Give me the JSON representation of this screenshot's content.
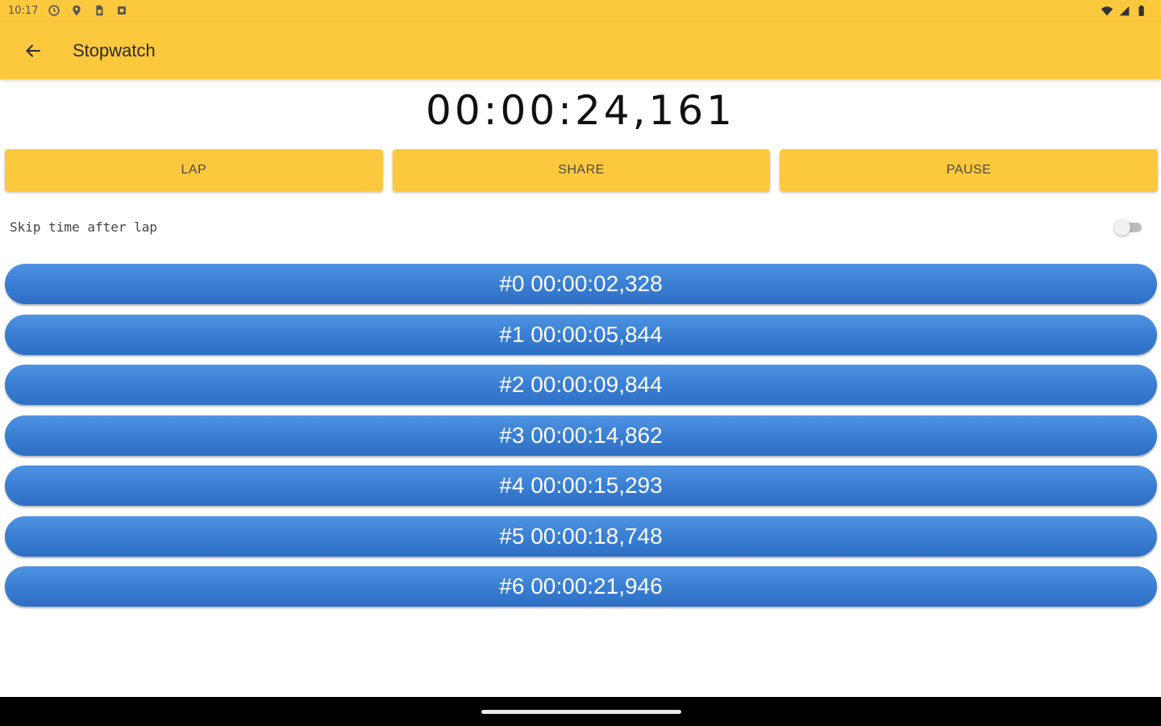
{
  "status_bar": {
    "time": "10:17",
    "left_icons": [
      "clock-icon",
      "location-icon",
      "sim-icon",
      "square-icon"
    ],
    "right_icons": [
      "wifi-icon",
      "signal-icon",
      "battery-icon"
    ]
  },
  "app_bar": {
    "title": "Stopwatch",
    "back_icon": "arrow-left-icon",
    "background": "#fcc83e"
  },
  "timer": {
    "display": "00:00:24,161"
  },
  "buttons": {
    "lap": "LAP",
    "share": "SHARE",
    "pause": "PAUSE",
    "color": "#fcc83e"
  },
  "skip_option": {
    "label": "Skip time after lap",
    "enabled": false
  },
  "laps": [
    "#0 00:00:02,328",
    "#1 00:00:05,844",
    "#2 00:00:09,844",
    "#3 00:00:14,862",
    "#4 00:00:15,293",
    "#5 00:00:18,748",
    "#6 00:00:21,946"
  ],
  "lap_color": "#3a7fd3"
}
